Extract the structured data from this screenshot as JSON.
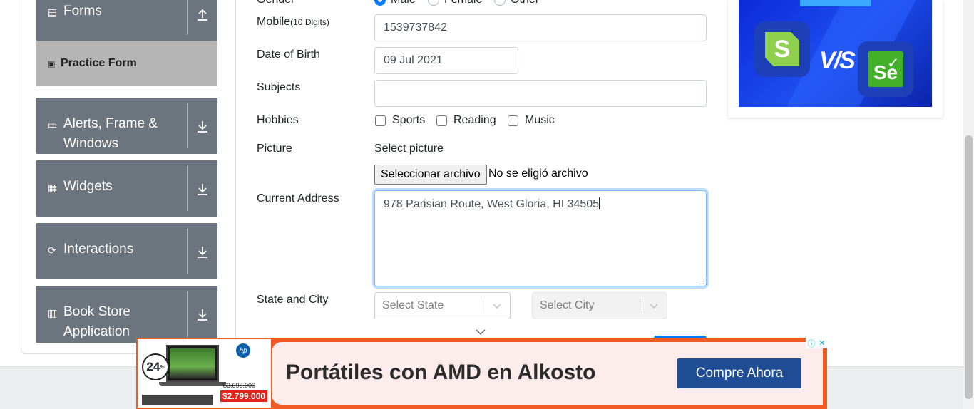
{
  "sidebar": {
    "groups": {
      "forms": "Forms",
      "practice_form": "Practice Form",
      "alerts": "Alerts, Frame & Windows",
      "widgets": "Widgets",
      "interactions": "Interactions",
      "book_store": "Book Store Application"
    }
  },
  "form": {
    "gender_label": "Gender",
    "gender_options": [
      "Male",
      "Female",
      "Other"
    ],
    "gender_selected": "Male",
    "mobile_label": "Mobile",
    "mobile_hint": "(10 Digits)",
    "mobile_value": "1539737842",
    "dob_label": "Date of Birth",
    "dob_value": "09 Jul 2021",
    "subjects_label": "Subjects",
    "subjects_value": "",
    "hobbies_label": "Hobbies",
    "hobbies": [
      "Sports",
      "Reading",
      "Music"
    ],
    "picture_label": "Picture",
    "picture_hint": "Select picture",
    "file_button": "Seleccionar archivo",
    "file_status": "No se eligió archivo",
    "address_label": "Current Address",
    "address_value": "978 Parisian Route, West Gloria, HI 34505",
    "state_city_label": "State and City",
    "state_placeholder": "Select State",
    "city_placeholder": "Select City"
  },
  "bottom_ad": {
    "headline": "Portátiles con AMD en Alkosto",
    "cta": "Compre Ahora",
    "discount": "24",
    "old_price": "$3.699.000",
    "new_price": "$2.799.000"
  },
  "colors": {
    "sidebar_group": "#6c757d",
    "sidebar_active": "#b5b5b5",
    "accent": "#007bff",
    "ad_orange": "#f05a23",
    "ad_button": "#1f4e96"
  }
}
